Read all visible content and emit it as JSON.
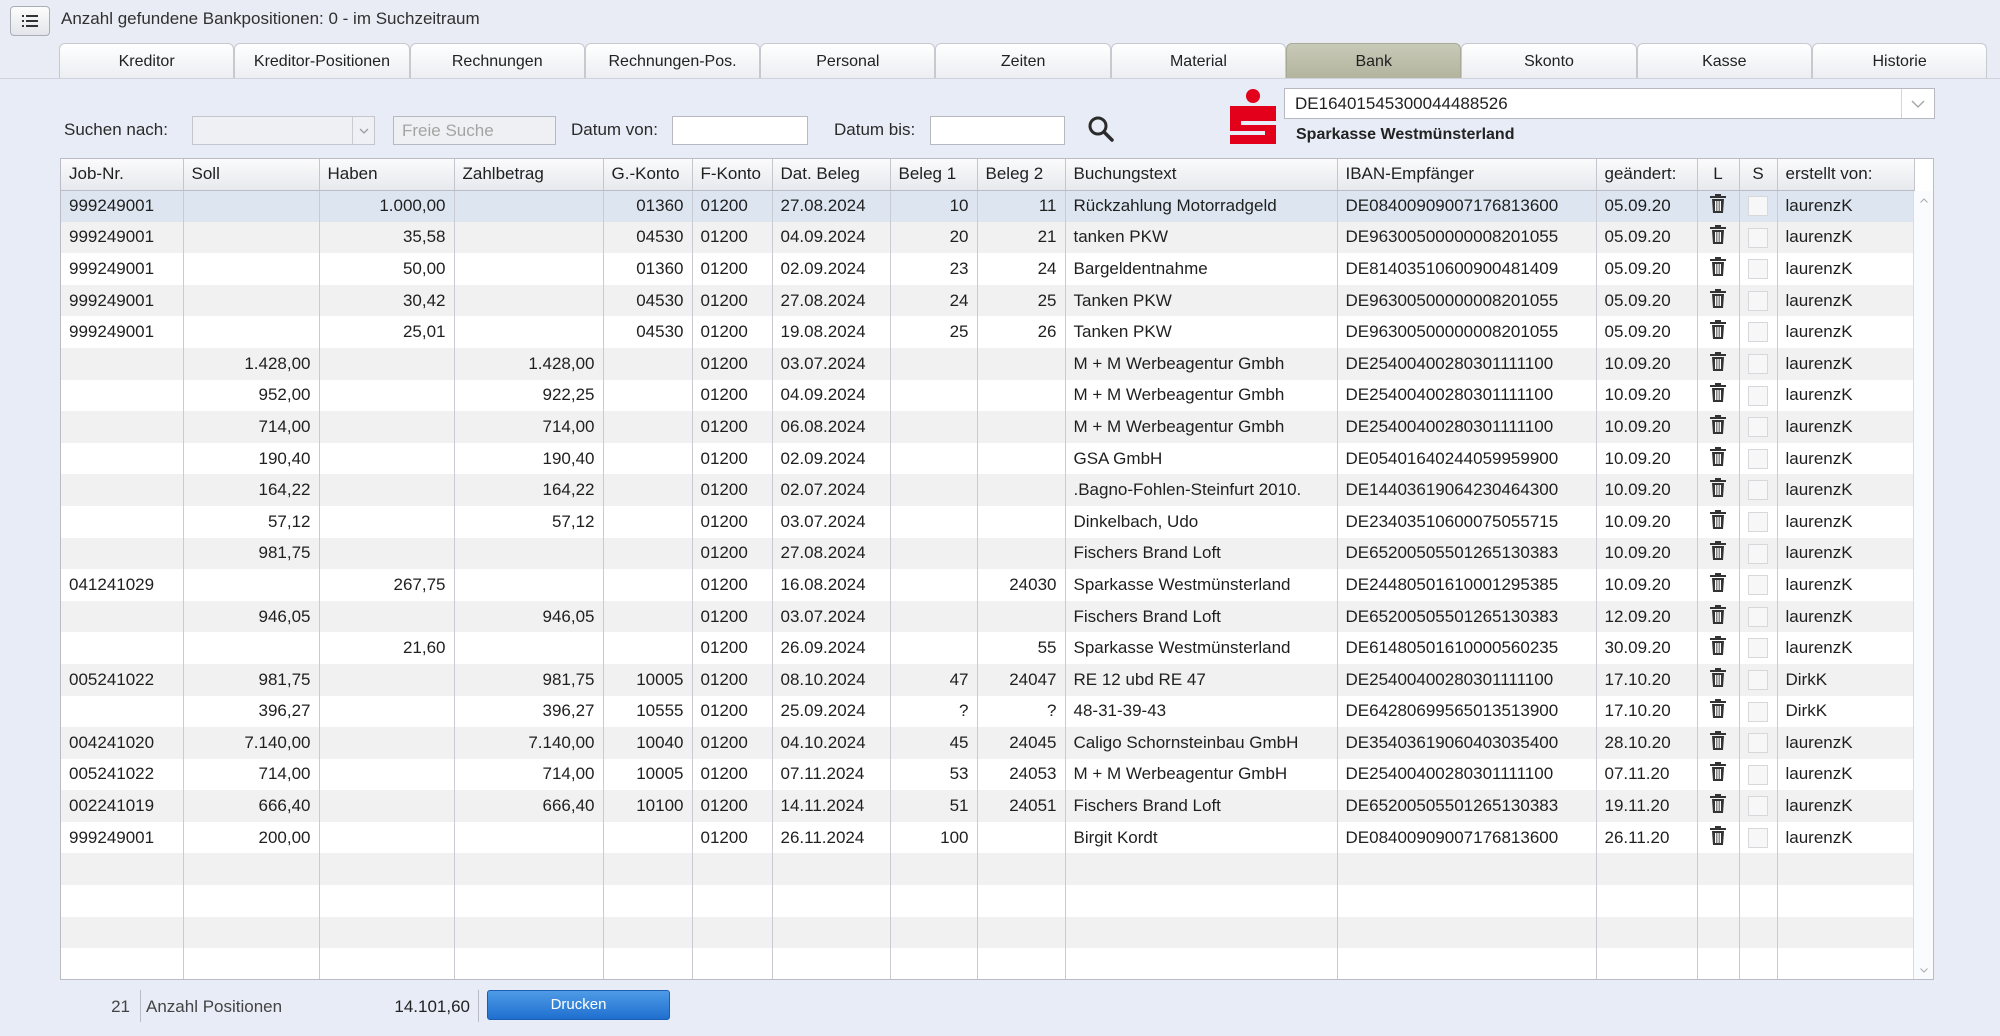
{
  "header": {
    "title": "Anzahl gefundene Bankpositionen: 0 - im Suchzeitraum"
  },
  "tabs": [
    {
      "label": "Kreditor"
    },
    {
      "label": "Kreditor-Positionen"
    },
    {
      "label": "Rechnungen"
    },
    {
      "label": "Rechnungen-Pos."
    },
    {
      "label": "Personal"
    },
    {
      "label": "Zeiten"
    },
    {
      "label": "Material"
    },
    {
      "label": "Bank",
      "active": true
    },
    {
      "label": "Skonto"
    },
    {
      "label": "Kasse"
    },
    {
      "label": "Historie"
    }
  ],
  "search": {
    "search_by_label": "Suchen nach:",
    "search_by_value": "",
    "free_search_placeholder": "Freie Suche",
    "date_from_label": "Datum von:",
    "date_from_value": "",
    "date_to_label": "Datum bis:",
    "date_to_value": ""
  },
  "bank": {
    "iban": "DE16401545300044488526",
    "name": "Sparkasse Westmünsterland",
    "brand_color": "#e2001a"
  },
  "table": {
    "columns": [
      "Job-Nr.",
      "Soll",
      "Haben",
      "Zahlbetrag",
      "G.-Konto",
      "F-Konto",
      "Dat. Beleg",
      "Beleg 1",
      "Beleg 2",
      "Buchungstext",
      "IBAN-Empfänger",
      "geändert:",
      "L",
      "S",
      "erstellt von:"
    ],
    "rows": [
      [
        "999249001",
        "",
        "1.000,00",
        "",
        "01360",
        "01200",
        "27.08.2024",
        "10",
        "11",
        "Rückzahlung Motorradgeld",
        "DE08400909007176813600",
        "05.09.20",
        "laurenzK"
      ],
      [
        "999249001",
        "",
        "35,58",
        "",
        "04530",
        "01200",
        "04.09.2024",
        "20",
        "21",
        "tanken PKW",
        "DE96300500000008201055",
        "05.09.20",
        "laurenzK"
      ],
      [
        "999249001",
        "",
        "50,00",
        "",
        "01360",
        "01200",
        "02.09.2024",
        "23",
        "24",
        "Bargeldentnahme",
        "DE81403510600900481409",
        "05.09.20",
        "laurenzK"
      ],
      [
        "999249001",
        "",
        "30,42",
        "",
        "04530",
        "01200",
        "27.08.2024",
        "24",
        "25",
        "Tanken PKW",
        "DE96300500000008201055",
        "05.09.20",
        "laurenzK"
      ],
      [
        "999249001",
        "",
        "25,01",
        "",
        "04530",
        "01200",
        "19.08.2024",
        "25",
        "26",
        "Tanken PKW",
        "DE96300500000008201055",
        "05.09.20",
        "laurenzK"
      ],
      [
        "",
        "1.428,00",
        "",
        "1.428,00",
        "",
        "01200",
        "03.07.2024",
        "",
        "",
        "M + M Werbeagentur Gmbh",
        "DE25400400280301111100",
        "10.09.20",
        "laurenzK"
      ],
      [
        "",
        "952,00",
        "",
        "922,25",
        "",
        "01200",
        "04.09.2024",
        "",
        "",
        "M + M Werbeagentur Gmbh",
        "DE25400400280301111100",
        "10.09.20",
        "laurenzK"
      ],
      [
        "",
        "714,00",
        "",
        "714,00",
        "",
        "01200",
        "06.08.2024",
        "",
        "",
        "M + M Werbeagentur Gmbh",
        "DE25400400280301111100",
        "10.09.20",
        "laurenzK"
      ],
      [
        "",
        "190,40",
        "",
        "190,40",
        "",
        "01200",
        "02.09.2024",
        "",
        "",
        "GSA GmbH",
        "DE05401640244059959900",
        "10.09.20",
        "laurenzK"
      ],
      [
        "",
        "164,22",
        "",
        "164,22",
        "",
        "01200",
        "02.07.2024",
        "",
        "",
        ".Bagno-Fohlen-Steinfurt 2010.",
        "DE14403619064230464300",
        "10.09.20",
        "laurenzK"
      ],
      [
        "",
        "57,12",
        "",
        "57,12",
        "",
        "01200",
        "03.07.2024",
        "",
        "",
        "Dinkelbach, Udo",
        "DE23403510600075055715",
        "10.09.20",
        "laurenzK"
      ],
      [
        "",
        "981,75",
        "",
        "",
        "",
        "01200",
        "27.08.2024",
        "",
        "",
        "Fischers Brand Loft",
        "DE65200505501265130383",
        "10.09.20",
        "laurenzK"
      ],
      [
        "041241029",
        "",
        "267,75",
        "",
        "",
        "01200",
        "16.08.2024",
        "",
        "24030",
        "Sparkasse Westmünsterland",
        "DE24480501610001295385",
        "10.09.20",
        "laurenzK"
      ],
      [
        "",
        "946,05",
        "",
        "946,05",
        "",
        "01200",
        "03.07.2024",
        "",
        "",
        "Fischers Brand Loft",
        "DE65200505501265130383",
        "12.09.20",
        "laurenzK"
      ],
      [
        "",
        "",
        "21,60",
        "",
        "",
        "01200",
        "26.09.2024",
        "",
        "55",
        "Sparkasse Westmünsterland",
        "DE61480501610000560235",
        "30.09.20",
        "laurenzK"
      ],
      [
        "005241022",
        "981,75",
        "",
        "981,75",
        "10005",
        "01200",
        "08.10.2024",
        "47",
        "24047",
        "RE 12 ubd RE 47",
        "DE25400400280301111100",
        "17.10.20",
        "DirkK"
      ],
      [
        "",
        "396,27",
        "",
        "396,27",
        "10555",
        "01200",
        "25.09.2024",
        "?",
        "?",
        "48-31-39-43",
        "DE64280699565013513900",
        "17.10.20",
        "DirkK"
      ],
      [
        "004241020",
        "7.140,00",
        "",
        "7.140,00",
        "10040",
        "01200",
        "04.10.2024",
        "45",
        "24045",
        "Caligo Schornsteinbau GmbH",
        "DE35403619060403035400",
        "28.10.20",
        "laurenzK"
      ],
      [
        "005241022",
        "714,00",
        "",
        "714,00",
        "10005",
        "01200",
        "07.11.2024",
        "53",
        "24053",
        "M + M Werbeagentur GmbH",
        "DE25400400280301111100",
        "07.11.20",
        "laurenzK"
      ],
      [
        "002241019",
        "666,40",
        "",
        "666,40",
        "10100",
        "01200",
        "14.11.2024",
        "51",
        "24051",
        "Fischers Brand Loft",
        "DE65200505501265130383",
        "19.11.20",
        "laurenzK"
      ],
      [
        "999249001",
        "200,00",
        "",
        "",
        "",
        "01200",
        "26.11.2024",
        "100",
        "",
        "Birgit Kordt",
        "DE08400909007176813600",
        "26.11.20",
        "laurenzK"
      ]
    ]
  },
  "footer": {
    "count": "21",
    "count_label": "Anzahl Positionen",
    "sum": "14.101,60",
    "print_label": "Drucken"
  }
}
